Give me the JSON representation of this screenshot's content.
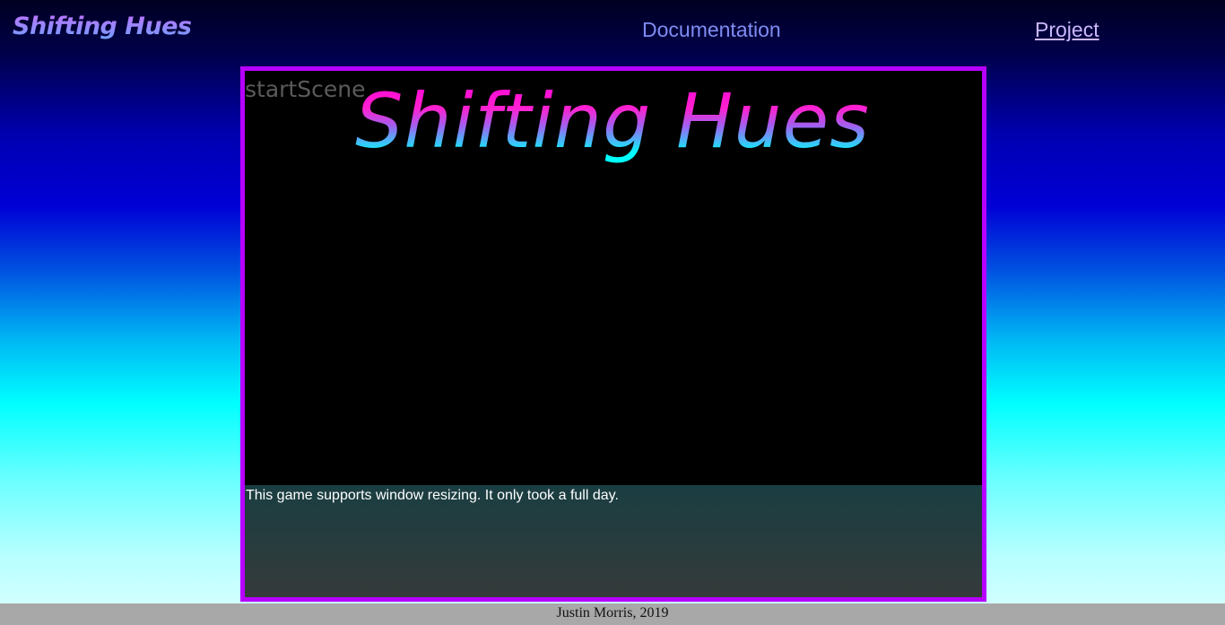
{
  "nav": {
    "brand": "Shifting Hues",
    "links": [
      {
        "label": "Documentation"
      },
      {
        "label": "Project"
      }
    ]
  },
  "game": {
    "scene_label": "startScene",
    "title": "Shifting Hues",
    "info_text": "This game supports window resizing. It only took a full day."
  },
  "footer": {
    "text": "Justin Morris, 2019"
  },
  "colors": {
    "frame_border": "#b700ff",
    "title_top": "#ff00d8",
    "title_bottom": "#00ffff",
    "nav_link": "#7f8cf2"
  }
}
